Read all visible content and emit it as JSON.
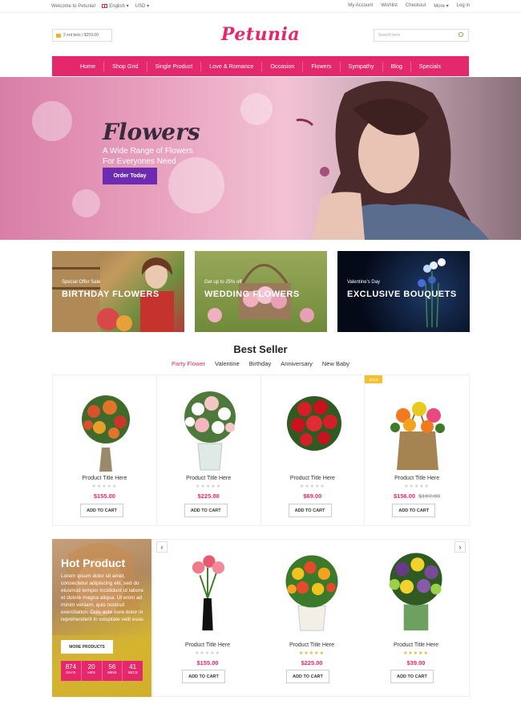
{
  "topbar": {
    "welcome": "Welcome to Petunia!",
    "language": "English ▾",
    "currency": "USD ▾",
    "links": [
      "My Account",
      "Wishlist",
      "Checkout",
      "More ▾",
      "Log in"
    ]
  },
  "header": {
    "cart_text": "2 ent bels / $259.00",
    "logo": "Petunia",
    "search_placeholder": "Search here"
  },
  "nav": [
    "Home",
    "Shop Grid",
    "Single Product",
    "Love & Romance",
    "Occasion",
    "Flowers",
    "Sympathy",
    "Blog",
    "Specials"
  ],
  "hero": {
    "title": "Flowers",
    "subtitle_line1": "A Wide Range of Flowers",
    "subtitle_line2": "For Everyones Need",
    "button": "Order Today"
  },
  "banners": [
    {
      "small": "Special Offer Sale",
      "big": "BIRTHDAY FLOWERS"
    },
    {
      "small": "Get up to 25% off",
      "big": "WEDDING FLOWERS"
    },
    {
      "small": "Valentine's Day",
      "big": "EXCLUSIVE BOUQUETS"
    }
  ],
  "best_seller": {
    "title": "Best Seller",
    "tabs": [
      "Party Flower",
      "Valentine",
      "Birthday",
      "Anniversary",
      "New Baby"
    ],
    "products": [
      {
        "name": "Product Title Here",
        "price": "$155.00",
        "old_price": "",
        "stars": "★★★★★",
        "sale": ""
      },
      {
        "name": "Product Title Here",
        "price": "$225.00",
        "old_price": "",
        "stars": "★★★★★",
        "sale": ""
      },
      {
        "name": "Product Title Here",
        "price": "$69.00",
        "old_price": "",
        "stars": "★★★★★",
        "sale": ""
      },
      {
        "name": "Product Title Here",
        "price": "$156.00",
        "old_price": "$167.00",
        "stars": "★★★★★",
        "sale": "SALE"
      }
    ],
    "add_to_cart": "ADD TO CART"
  },
  "hot_product": {
    "title": "Hot Product",
    "text": "Lorem ipsum dolor sit amet, consectetur adipiscing elit, sed do eiusmod tempor incididunt ut labore et dolore magna aliqua. Ut enim ad minim veniam, quis nostrud exercitation. Duis aute irure dolor in reprehenderit in voluptate velit esse.",
    "button": "MORE PRODUCTS",
    "countdown": [
      {
        "n": "874",
        "u": "DAYS"
      },
      {
        "n": "20",
        "u": "HRS"
      },
      {
        "n": "56",
        "u": "MINS"
      },
      {
        "n": "41",
        "u": "SECS"
      }
    ],
    "products": [
      {
        "name": "Product Title Here",
        "price": "$155.00",
        "stars": "★★★★★"
      },
      {
        "name": "Product Title Here",
        "price": "$225.00",
        "stars": "★★★★★"
      },
      {
        "name": "Product Title Here",
        "price": "$39.00",
        "stars": "★★★★★"
      }
    ],
    "add_to_cart": "ADD TO CART",
    "prev": "‹",
    "next": "›"
  },
  "colors": {
    "brand": "#e5286b",
    "button_purple": "#6c2bb0",
    "sale": "#f2c12e"
  }
}
